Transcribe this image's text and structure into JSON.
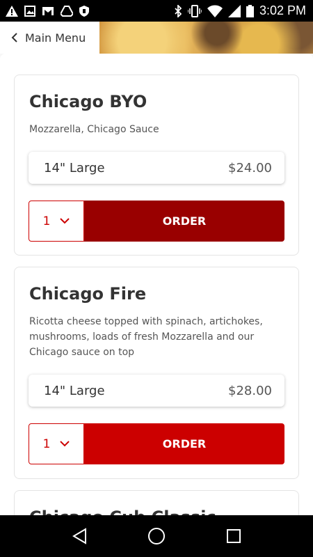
{
  "status_bar": {
    "time": "3:02 PM",
    "left_icons": [
      "warning-icon",
      "image-icon",
      "gmail-icon",
      "drive-icon",
      "shield-icon"
    ],
    "right_icons": [
      "bluetooth-icon",
      "vibrate-icon",
      "wifi-icon",
      "signal-icon",
      "battery-icon"
    ]
  },
  "header": {
    "back_label": "Main Menu"
  },
  "items": [
    {
      "title": "Chicago BYO",
      "description": "Mozzarella, Chicago Sauce",
      "size_label": "14\" Large",
      "price": "$24.00",
      "quantity": "1",
      "order_label": "ORDER",
      "order_color": "#990000"
    },
    {
      "title": "Chicago Fire",
      "description": "Ricotta cheese topped with spinach, artichokes, mushrooms, loads of fresh Mozzarella and our Chicago sauce on top",
      "size_label": "14\" Large",
      "price": "$28.00",
      "quantity": "1",
      "order_label": "ORDER",
      "order_color": "#cc0000"
    },
    {
      "title": "Chicago Cub Classic"
    }
  ],
  "colors": {
    "accent_red": "#cc0000",
    "accent_dark_red": "#990000"
  }
}
